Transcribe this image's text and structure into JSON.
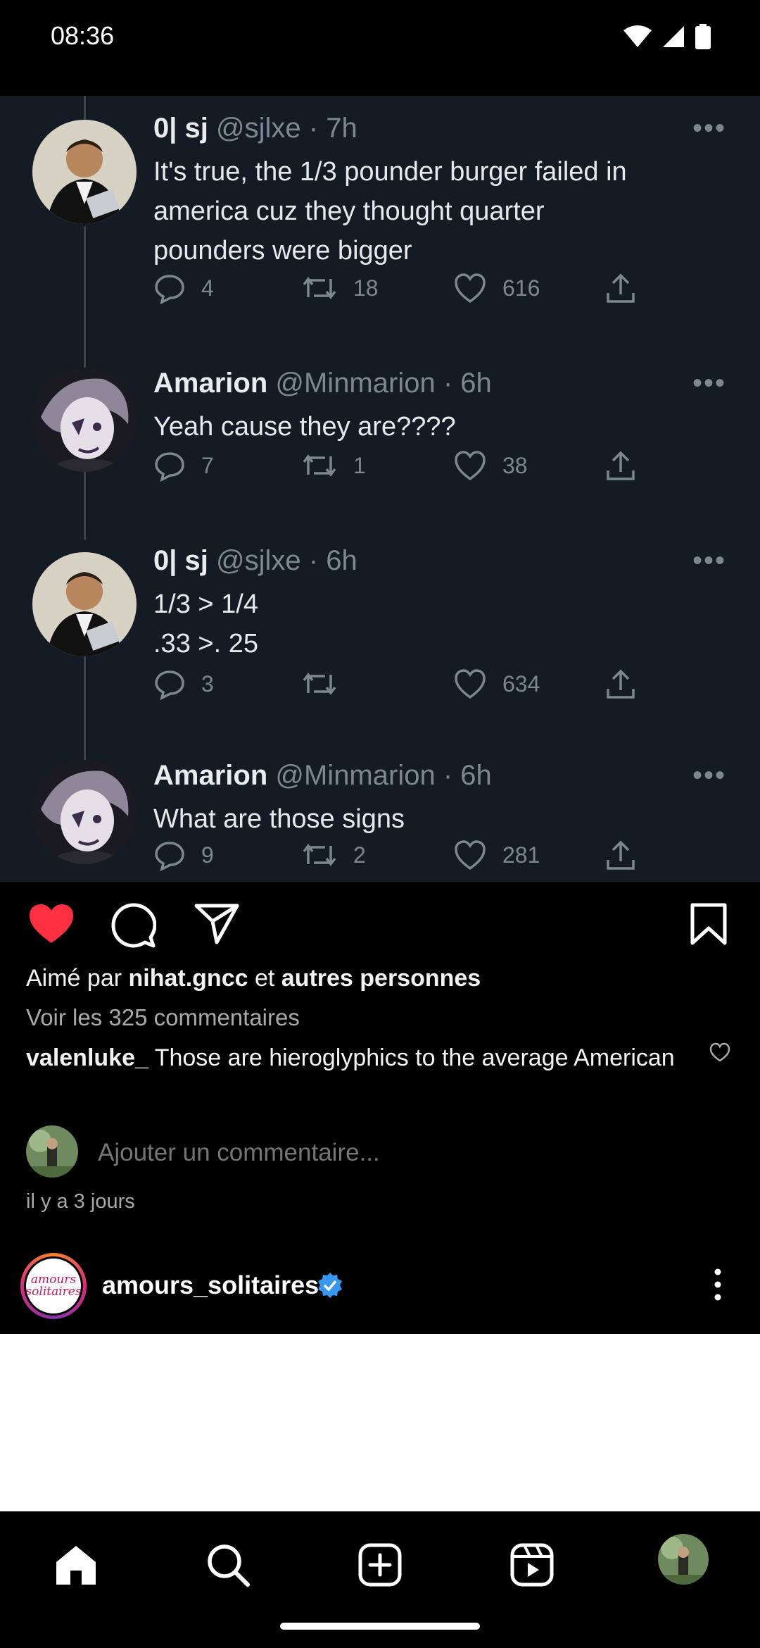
{
  "status_bar": {
    "time": "08:36"
  },
  "tweets": [
    {
      "name": "0| sj",
      "handle": "@sjlxe · 7h",
      "lines": [
        "It's true, the 1/3 pounder burger failed in",
        "america cuz they thought quarter",
        "pounders were bigger"
      ],
      "replies": "4",
      "retweets": "18",
      "likes": "616"
    },
    {
      "name": "Amarion",
      "handle": "@Minmarion · 6h",
      "lines": [
        "Yeah cause they are????"
      ],
      "replies": "7",
      "retweets": "1",
      "likes": "38"
    },
    {
      "name": "0| sj",
      "handle": "@sjlxe · 6h",
      "lines": [
        "1/3 > 1/4",
        ".33 >. 25"
      ],
      "replies": "3",
      "retweets": "",
      "likes": "634"
    },
    {
      "name": "Amarion",
      "handle": "@Minmarion · 6h",
      "lines": [
        "What are those signs"
      ],
      "replies": "9",
      "retweets": "2",
      "likes": "281"
    }
  ],
  "post": {
    "liked": true,
    "likes_prefix": "Aimé par ",
    "likes_user": "nihat.gncc",
    "likes_mid": " et ",
    "likes_others": "autres personnes",
    "view_comments": "Voir les 325 commentaires",
    "comment_user": "valenluke_",
    "comment_text": " Those are hieroglyphics to the average American",
    "add_comment_placeholder": "Ajouter un commentaire...",
    "time_ago": "il y a 3 jours"
  },
  "next_post": {
    "username": "amours_solitaires",
    "verified": true,
    "avatar_text": "amours solitaires"
  },
  "colors": {
    "like_red": "#ff3040",
    "verified_blue": "#3897f0",
    "tweet_bg": "#151b24"
  },
  "icons": {
    "like": "heart-filled-icon",
    "comment": "comment-bubble-icon",
    "share": "paper-plane-icon",
    "save": "bookmark-icon",
    "more": "more-vertical-icon",
    "nav": [
      "home-icon",
      "search-icon",
      "create-post-icon",
      "reels-icon",
      "profile-avatar"
    ]
  }
}
